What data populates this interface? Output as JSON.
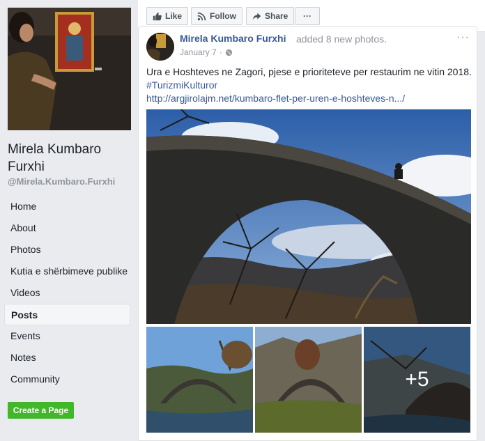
{
  "sidebar": {
    "page_name": "Mirela Kumbaro Furxhi",
    "handle": "@Mirela.Kumbaro.Furxhi",
    "nav": [
      {
        "label": "Home"
      },
      {
        "label": "About"
      },
      {
        "label": "Photos"
      },
      {
        "label": "Kutia e shërbimeve publike"
      },
      {
        "label": "Videos"
      },
      {
        "label": "Posts",
        "active": true
      },
      {
        "label": "Events"
      },
      {
        "label": "Notes"
      },
      {
        "label": "Community"
      }
    ],
    "create_page_label": "Create a Page"
  },
  "action_bar": {
    "like_label": "Like",
    "follow_label": "Follow",
    "share_label": "Share",
    "more_label": "···"
  },
  "post": {
    "author": "Mirela Kumbaro Furxhi",
    "verb": "added 8 new photos.",
    "date": "January 7",
    "dot": "·",
    "menu": "···",
    "text": "Ura e Hoshteves ne Zagori, pjese e prioriteteve per restaurim ne vitin 2018.",
    "hashtag": "#TurizmiKulturor",
    "link": "http://argjirolajm.net/kumbaro-flet-per-uren-e-hoshteves-n.../",
    "more_photos_label": "+5"
  },
  "colors": {
    "link": "#365899",
    "create_button": "#42b72a",
    "background": "#e9ebee"
  }
}
